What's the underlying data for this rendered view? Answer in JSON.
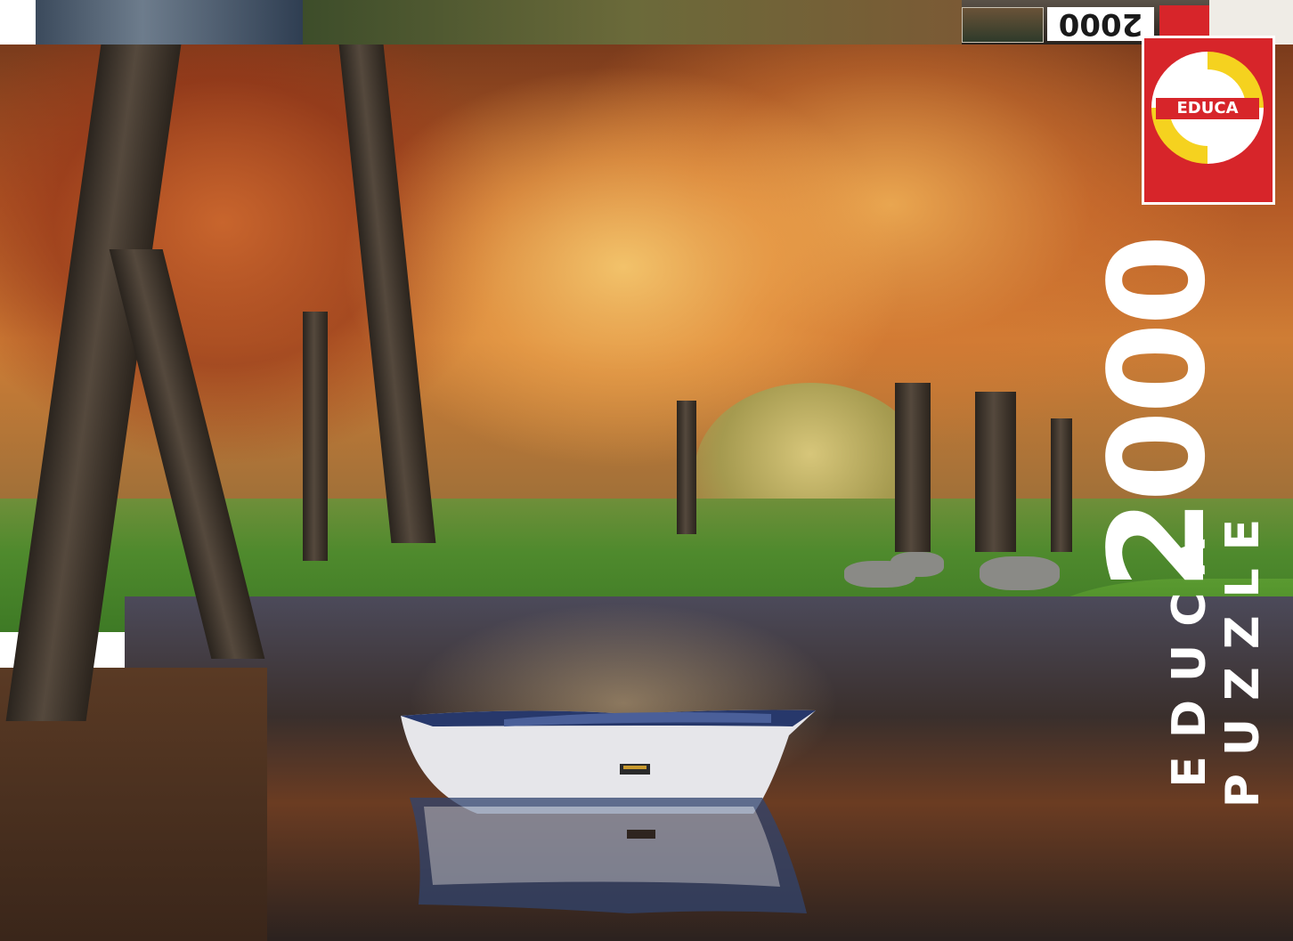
{
  "box": {
    "lid_number": "2000",
    "brand": "EDUCA",
    "piece_count": "2000",
    "side_brand": "EDUCA",
    "side_type": "PUZZLE"
  },
  "colors": {
    "brand_red": "#d7252a",
    "logo_yellow": "#f5d21f",
    "text_white": "#ffffff"
  },
  "icons": {
    "logo": "educa-logo-icon",
    "boat": "rowboat-icon"
  }
}
